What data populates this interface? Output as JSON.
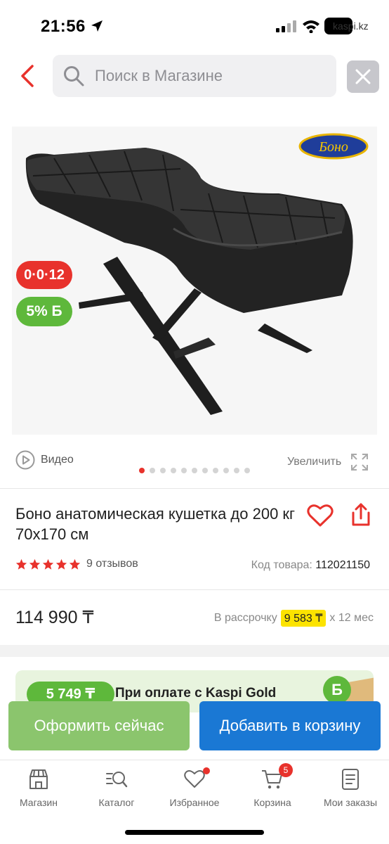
{
  "status_bar": {
    "time": "21:56",
    "site": "kaspi.kz",
    "icons": [
      "location-arrow-icon",
      "signal-icon",
      "wifi-icon",
      "battery-icon"
    ]
  },
  "search": {
    "placeholder": "Поиск в Магазине",
    "value": ""
  },
  "gallery": {
    "brand_logo": "Боно",
    "badge_installment": "0·0·12",
    "badge_bonus": "5% Б",
    "video_label": "Видео",
    "zoom_label": "Увеличить",
    "slides_count": 11,
    "active_slide": 1
  },
  "product": {
    "title": "Боно анатомическая кушетка до 200 кг 70x170 см",
    "rating": 5,
    "reviews": "9 отзывов",
    "sku_label": "Код товара:",
    "sku_value": "112021150",
    "price": "114 990 ₸",
    "installment_prefix": "В рассрочку",
    "installment_amount": "9 583 ₸",
    "installment_suffix": "x 12 мес"
  },
  "promo": {
    "pill": "5 749 ₸",
    "text": "При оплате с Kaspi Gold"
  },
  "actions": {
    "buy_now": "Оформить сейчас",
    "add_to_cart": "Добавить в корзину"
  },
  "tabs": [
    {
      "label": "Магазин",
      "icon": "store-icon"
    },
    {
      "label": "Каталог",
      "icon": "catalog-search-icon"
    },
    {
      "label": "Избранное",
      "icon": "heart-icon"
    },
    {
      "label": "Корзина",
      "icon": "cart-icon",
      "badge": "5"
    },
    {
      "label": "Мои заказы",
      "icon": "orders-icon"
    }
  ],
  "colors": {
    "accent_red": "#e8322c",
    "bonus_green": "#5eb83b",
    "cart_blue": "#1a78d4",
    "installment_yellow": "#fce300"
  }
}
